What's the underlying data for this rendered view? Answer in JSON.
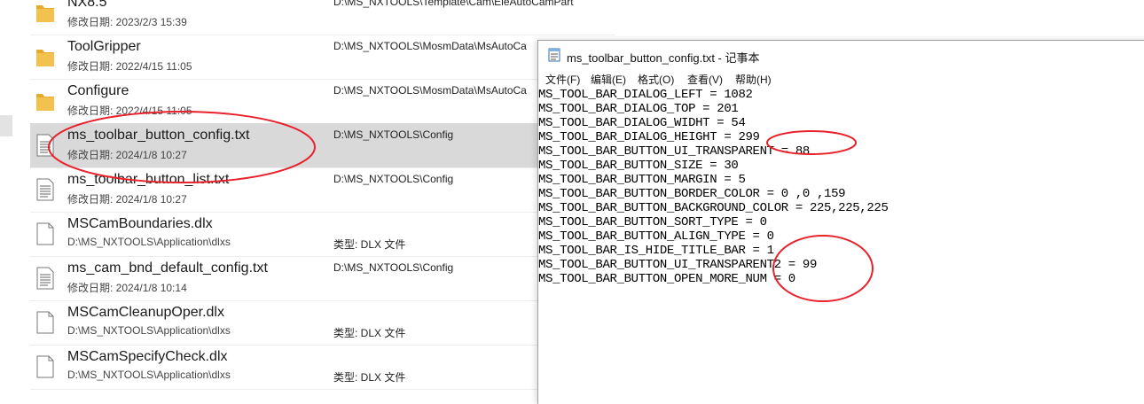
{
  "explorer": {
    "rows": [
      {
        "name": "NX8.5",
        "sub": "修改日期: 2023/2/3 15:39",
        "path": "D:\\MS_NXTOOLS\\Template\\Cam\\EleAutoCamPart",
        "type": "",
        "icon": "folder-icon"
      },
      {
        "name": "ToolGripper",
        "sub": "修改日期: 2022/4/15 11:05",
        "path": "D:\\MS_NXTOOLS\\MosmData\\MsAutoCa",
        "type": "",
        "icon": "folder-icon"
      },
      {
        "name": "Configure",
        "sub": "修改日期: 2022/4/15 11:05",
        "path": "D:\\MS_NXTOOLS\\MosmData\\MsAutoCa",
        "type": "",
        "icon": "folder-icon"
      },
      {
        "name": "ms_toolbar_button_config.txt",
        "sub": "修改日期: 2024/1/8 10:27",
        "path": "D:\\MS_NXTOOLS\\Config",
        "type": "",
        "icon": "text-file-icon"
      },
      {
        "name": "ms_toolbar_button_list.txt",
        "sub": "修改日期: 2024/1/8 10:27",
        "path": "D:\\MS_NXTOOLS\\Config",
        "type": "",
        "icon": "text-file-icon"
      },
      {
        "name": "MSCamBoundaries.dlx",
        "sub": "D:\\MS_NXTOOLS\\Application\\dlxs",
        "path": "",
        "type": "类型: DLX 文件",
        "icon": "blank-file-icon"
      },
      {
        "name": "ms_cam_bnd_default_config.txt",
        "sub": "修改日期: 2024/1/8 10:14",
        "path": "D:\\MS_NXTOOLS\\Config",
        "type": "",
        "icon": "text-file-icon"
      },
      {
        "name": "MSCamCleanupOper.dlx",
        "sub": "D:\\MS_NXTOOLS\\Application\\dlxs",
        "path": "",
        "type": "类型: DLX 文件",
        "icon": "blank-file-icon"
      },
      {
        "name": "MSCamSpecifyCheck.dlx",
        "sub": "D:\\MS_NXTOOLS\\Application\\dlxs",
        "path": "",
        "type": "类型: DLX 文件",
        "icon": "blank-file-icon"
      }
    ],
    "selected_index": 3
  },
  "notepad": {
    "title": "ms_toolbar_button_config.txt - 记事本",
    "menu": [
      "文件(F)",
      "编辑(E)",
      "格式(O)",
      "查看(V)",
      "帮助(H)"
    ],
    "lines": [
      "MS_TOOL_BAR_DIALOG_LEFT = 1082",
      "MS_TOOL_BAR_DIALOG_TOP = 201",
      "MS_TOOL_BAR_DIALOG_WIDHT = 54",
      "MS_TOOL_BAR_DIALOG_HEIGHT = 299",
      "MS_TOOL_BAR_BUTTON_UI_TRANSPARENT = 88",
      "MS_TOOL_BAR_BUTTON_SIZE = 30",
      "MS_TOOL_BAR_BUTTON_MARGIN = 5",
      "MS_TOOL_BAR_BUTTON_BORDER_COLOR = 0 ,0 ,159",
      "MS_TOOL_BAR_BUTTON_BACKGROUND_COLOR = 225,225,225",
      "MS_TOOL_BAR_BUTTON_SORT_TYPE = 0",
      "MS_TOOL_BAR_BUTTON_ALIGN_TYPE = 0",
      "MS_TOOL_BAR_IS_HIDE_TITLE_BAR = 1",
      "MS_TOOL_BAR_BUTTON_UI_TRANSPARENT2 = 99",
      "MS_TOOL_BAR_BUTTON_OPEN_MORE_NUM = 0"
    ]
  },
  "colors": {
    "annotation_red": "#e8202a",
    "folder_yellow": "#f2c14e",
    "selection_gray": "#d9d9d9"
  }
}
